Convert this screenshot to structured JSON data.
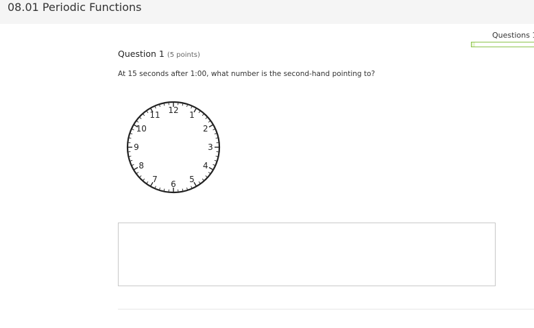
{
  "header": {
    "title": "08.01 Periodic Functions"
  },
  "progress": {
    "label": "Questions 1",
    "fraction": 0.05
  },
  "question": {
    "heading": "Question 1",
    "points": "(5 points)",
    "text": "At 15 seconds after 1:00, what number is the second-hand pointing to?",
    "image": {
      "icon": "analog-clock-image",
      "numbers": [
        "12",
        "1",
        "2",
        "3",
        "4",
        "5",
        "6",
        "7",
        "8",
        "9",
        "10",
        "11"
      ]
    }
  },
  "answer": {
    "value": ""
  }
}
